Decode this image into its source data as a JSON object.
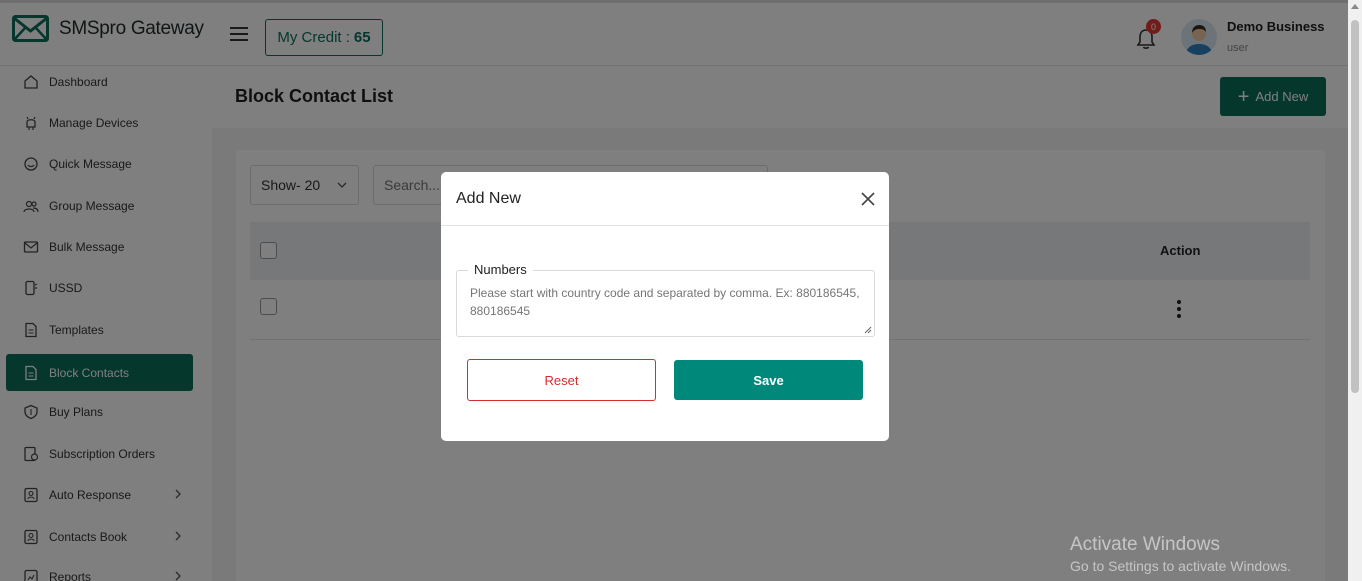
{
  "app": {
    "brand_name": "SMSpro Gateway",
    "credit_label": "My Credit :",
    "credit_value": "65",
    "notification_count": "0",
    "user_name": "Demo Business",
    "user_role": "user"
  },
  "sidebar": {
    "items": [
      {
        "label": "Dashboard",
        "icon": "home-icon"
      },
      {
        "label": "Manage Devices",
        "icon": "android-icon"
      },
      {
        "label": "Quick Message",
        "icon": "chat-icon"
      },
      {
        "label": "Group Message",
        "icon": "group-icon"
      },
      {
        "label": "Bulk Message",
        "icon": "mail-icon"
      },
      {
        "label": "USSD",
        "icon": "phone-icon"
      },
      {
        "label": "Templates",
        "icon": "document-icon"
      },
      {
        "label": "Block Contacts",
        "icon": "document-icon"
      },
      {
        "label": "Buy Plans",
        "icon": "shield-icon"
      },
      {
        "label": "Subscription Orders",
        "icon": "orders-icon"
      },
      {
        "label": "Auto Response",
        "icon": "contact-card-icon"
      },
      {
        "label": "Contacts Book",
        "icon": "contact-card-icon"
      },
      {
        "label": "Reports",
        "icon": "report-icon"
      }
    ],
    "active": "Block Contacts"
  },
  "page": {
    "title": "Block Contact List",
    "add_new_label": "Add New",
    "show_label": "Show- 20",
    "search_placeholder": "Search...",
    "table": {
      "columns": [
        "",
        "Action"
      ],
      "rows": [
        {
          "checked": false
        }
      ]
    }
  },
  "modal": {
    "title": "Add New",
    "field_label": "Numbers",
    "field_placeholder": "Please start with country code and separated by comma. Ex: 880186545, 880186545",
    "reset_label": "Reset",
    "save_label": "Save"
  },
  "watermark": {
    "title": "Activate Windows",
    "subtitle": "Go to Settings to activate Windows."
  },
  "colors": {
    "brand_green": "#0b6e5a",
    "save_green": "#00897b",
    "reset_red": "#d32f2f",
    "badge_red": "#e53935"
  }
}
